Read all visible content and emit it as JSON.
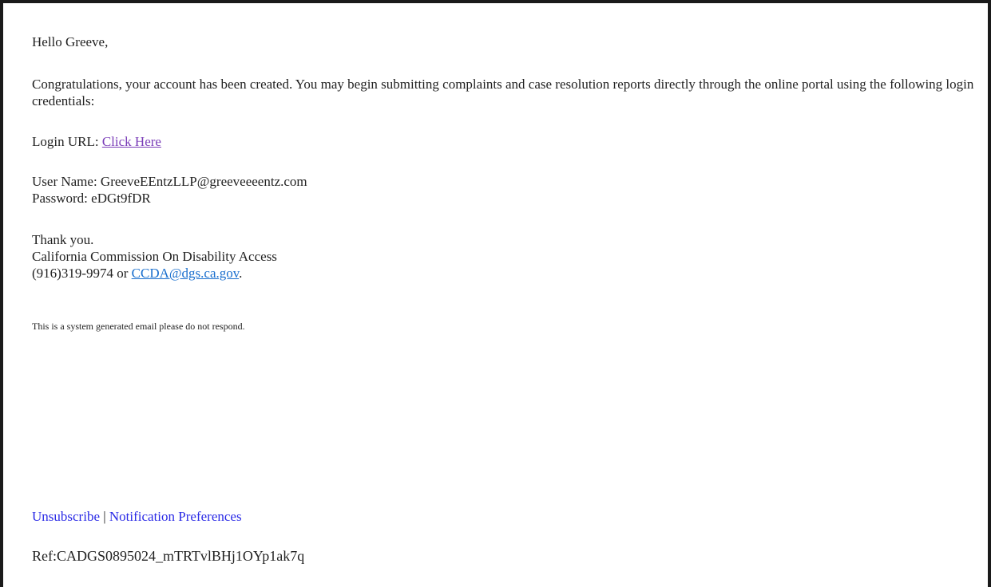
{
  "email": {
    "greeting": "Hello Greeve,",
    "intro": "Congratulations, your account has been created. You may begin submitting complaints and case resolution reports directly through the online portal using the following login credentials:",
    "login_url_label": "Login URL:",
    "login_url_link": "Click Here",
    "username_label": "User Name:",
    "username_value": "GreeveEEntzLLP@greeveeeentz.com",
    "password_label": "Password:",
    "password_value": "eDGt9fDR",
    "thanks": "Thank you.",
    "org_name": "California Commission On Disability Access",
    "phone": "(916)319-9974 or",
    "contact_email": "CCDA@dgs.ca.gov",
    "contact_trailing": ".",
    "system_note": "This is a system generated email please do not respond.",
    "footer": {
      "unsubscribe": "Unsubscribe",
      "separator": "|",
      "preferences": "Notification Preferences"
    },
    "reference": "Ref:CADGS0895024_mTRTvlBHj1OYp1ak7q"
  },
  "colors": {
    "border": "#1a1a1a",
    "text": "#222222",
    "visited_link": "#7a3db8",
    "email_link": "#1a6fce",
    "footer_link": "#2a2ae6"
  }
}
